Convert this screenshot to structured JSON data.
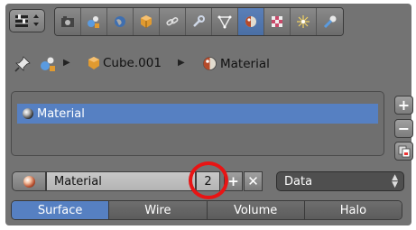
{
  "header": {
    "editor_icon": "properties-editor-icon",
    "tabs": [
      {
        "icon": "render-icon",
        "active": false
      },
      {
        "icon": "scene-icon",
        "active": false
      },
      {
        "icon": "world-icon",
        "active": false
      },
      {
        "icon": "object-icon",
        "active": false
      },
      {
        "icon": "constraints-icon",
        "active": false
      },
      {
        "icon": "modifier-wrench-icon",
        "active": false
      },
      {
        "icon": "mesh-data-icon",
        "active": false
      },
      {
        "icon": "material-icon",
        "active": true
      },
      {
        "icon": "texture-icon",
        "active": false
      },
      {
        "icon": "particles-icon",
        "active": false
      },
      {
        "icon": "physics-icon",
        "active": false
      }
    ]
  },
  "breadcrumb": {
    "object": "Cube.001",
    "material": "Material"
  },
  "material_slots": {
    "items": [
      {
        "label": "Material",
        "selected": true
      }
    ],
    "buttons": {
      "add": "+",
      "remove": "−"
    }
  },
  "material_row": {
    "name": "Material",
    "users": "2",
    "add": "+",
    "unlink": "✕",
    "link": "Data"
  },
  "type_tabs": [
    {
      "label": "Surface",
      "active": true
    },
    {
      "label": "Wire",
      "active": false
    },
    {
      "label": "Volume",
      "active": false
    },
    {
      "label": "Halo",
      "active": false
    }
  ],
  "colors": {
    "panel": "#737373",
    "accent": "#5680c2",
    "highlight_circle": "#e81414"
  }
}
